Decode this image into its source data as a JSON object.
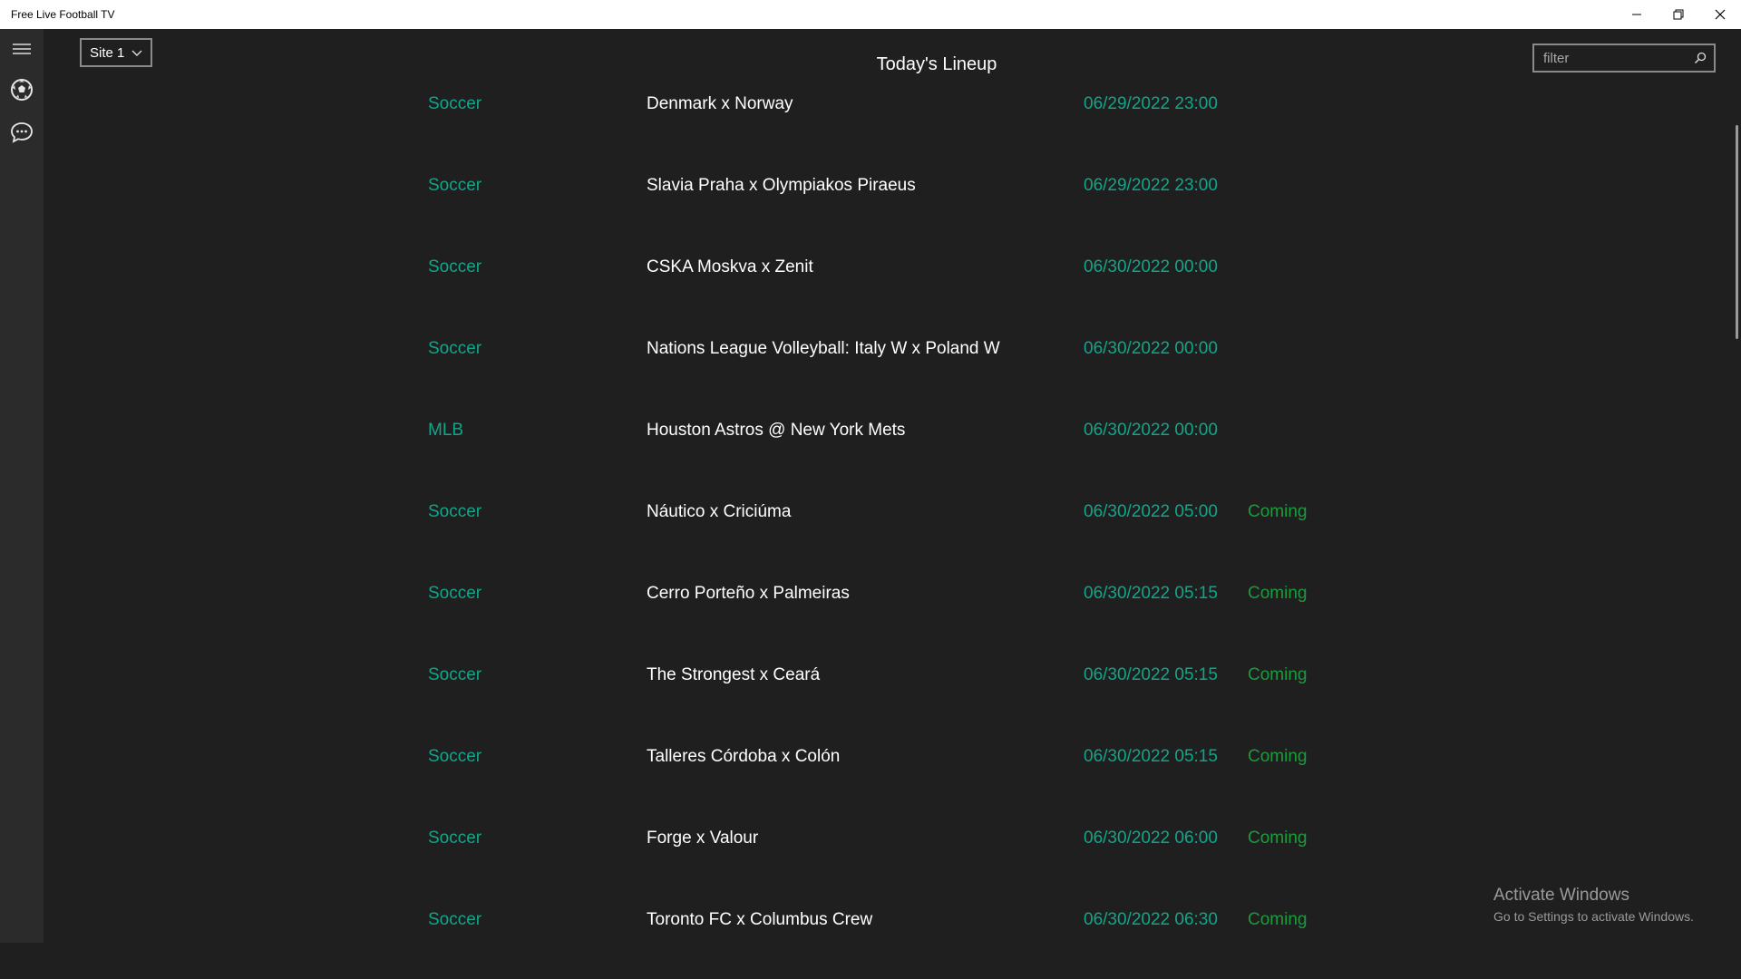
{
  "window": {
    "title": "Free Live Football TV"
  },
  "nav": {
    "items": [
      {
        "icon": "hamburger-menu-icon"
      },
      {
        "icon": "soccer-ball-icon"
      },
      {
        "icon": "chat-bubble-icon"
      }
    ]
  },
  "site_select": {
    "value": "Site 1"
  },
  "page": {
    "title": "Today's Lineup"
  },
  "search": {
    "placeholder": "filter",
    "value": ""
  },
  "lineup": [
    {
      "sport": "Soccer",
      "match": "Denmark x Norway",
      "time": "06/29/2022 23:00",
      "status": ""
    },
    {
      "sport": "Soccer",
      "match": "Slavia Praha x Olympiakos Piraeus",
      "time": "06/29/2022 23:00",
      "status": ""
    },
    {
      "sport": "Soccer",
      "match": "CSKA Moskva x Zenit",
      "time": "06/30/2022 00:00",
      "status": ""
    },
    {
      "sport": "Soccer",
      "match": "Nations League Volleyball: Italy W x Poland W",
      "time": "06/30/2022 00:00",
      "status": ""
    },
    {
      "sport": "MLB",
      "match": "Houston Astros @ New York Mets",
      "time": "06/30/2022 00:00",
      "status": ""
    },
    {
      "sport": "Soccer",
      "match": "Náutico x Criciúma",
      "time": "06/30/2022 05:00",
      "status": "Coming"
    },
    {
      "sport": "Soccer",
      "match": "Cerro Porteño x Palmeiras",
      "time": "06/30/2022 05:15",
      "status": "Coming"
    },
    {
      "sport": "Soccer",
      "match": "The Strongest x Ceará",
      "time": "06/30/2022 05:15",
      "status": "Coming"
    },
    {
      "sport": "Soccer",
      "match": "Talleres Córdoba x Colón",
      "time": "06/30/2022 05:15",
      "status": "Coming"
    },
    {
      "sport": "Soccer",
      "match": "Forge x Valour",
      "time": "06/30/2022 06:00",
      "status": "Coming"
    },
    {
      "sport": "Soccer",
      "match": "Toronto FC x Columbus Crew",
      "time": "06/30/2022 06:30",
      "status": "Coming"
    }
  ],
  "watermark": {
    "title": "Activate Windows",
    "subtitle": "Go to Settings to activate Windows."
  },
  "colors": {
    "background": "#1f1f1f",
    "nav_background": "#2b2b2b",
    "accent_teal": "#12a589",
    "status_green": "#1b9c3c"
  }
}
